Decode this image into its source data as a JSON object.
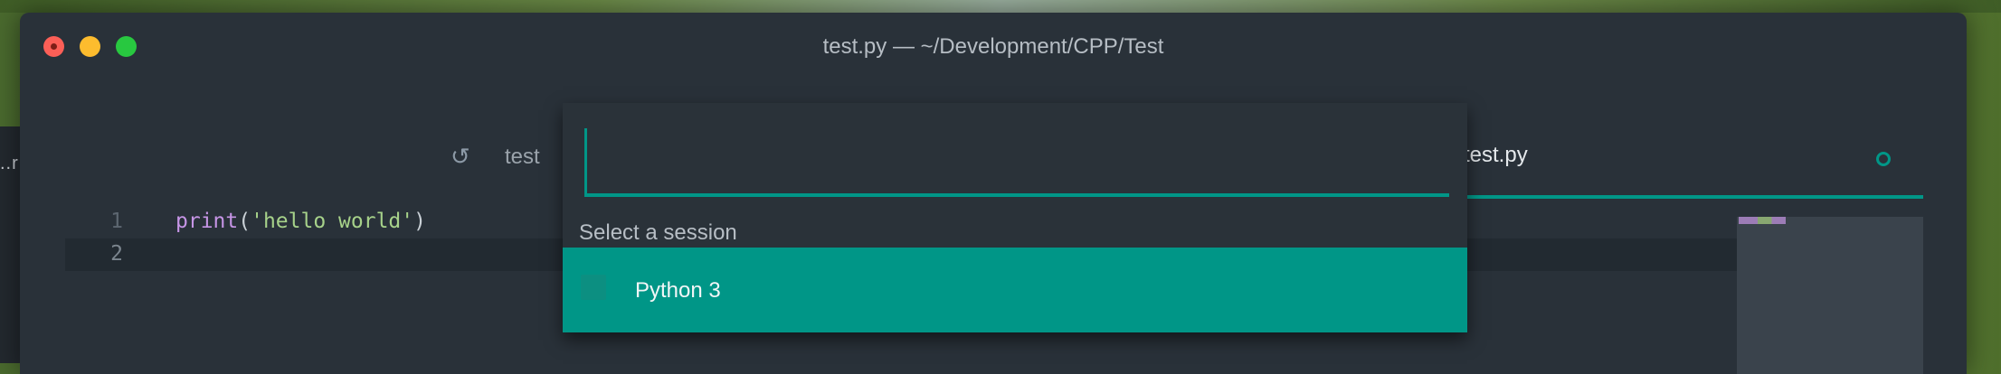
{
  "window": {
    "title": "test.py — ~/Development/CPP/Test"
  },
  "background": {
    "peek_text": "..r"
  },
  "tabs": [
    {
      "label": "test",
      "icon": "git-compare-icon"
    },
    {
      "label": "test.py",
      "active": true,
      "status": "modified-dot-icon"
    }
  ],
  "editor": {
    "lines": [
      {
        "number": "1",
        "parts": [
          "print",
          "(",
          "'hello world'",
          ")"
        ]
      },
      {
        "number": "2",
        "parts": []
      }
    ]
  },
  "palette": {
    "input_value": "",
    "section_label": "Select a session",
    "items": [
      {
        "label": "Python 3",
        "selected": true
      }
    ]
  },
  "colors": {
    "accent": "#009687",
    "background": "#293139"
  }
}
